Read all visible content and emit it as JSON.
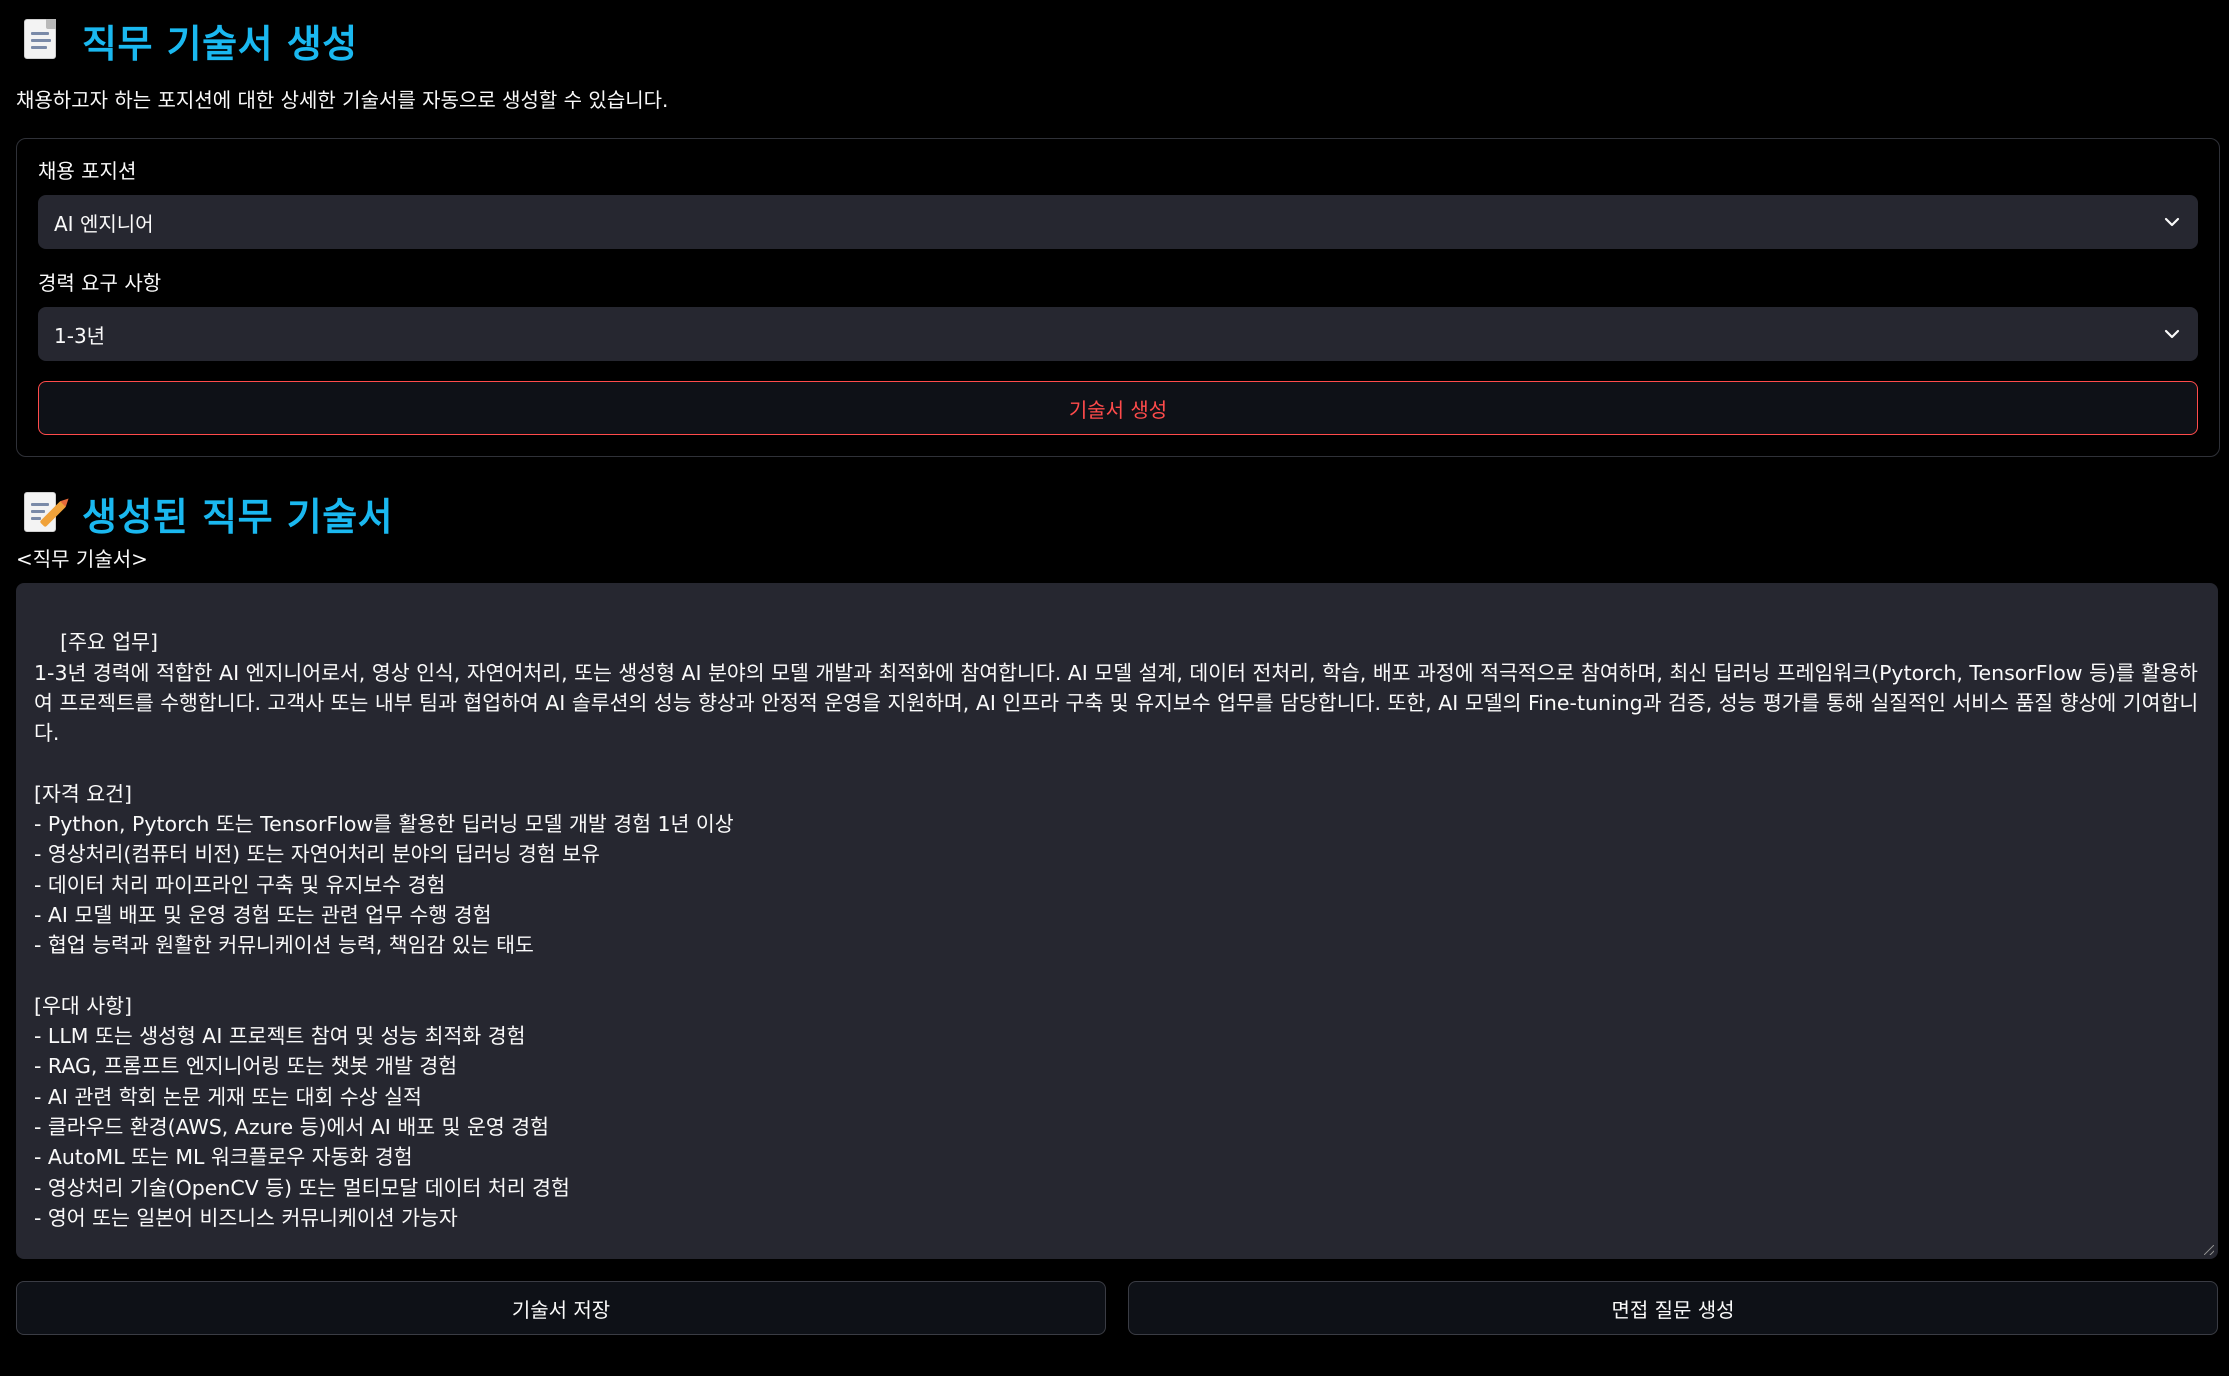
{
  "header": {
    "icon": "page-facing-up-icon",
    "title": "직무 기술서 생성",
    "description": "채용하고자 하는 포지션에 대한 상세한 기술서를 자동으로 생성할 수 있습니다."
  },
  "form": {
    "position": {
      "label": "채용 포지션",
      "selected": "AI 엔지니어"
    },
    "experience": {
      "label": "경력 요구 사항",
      "selected": "1-3년"
    },
    "generate_label": "기술서 생성"
  },
  "output": {
    "icon": "memo-icon",
    "title": "생성된 직무 기술서",
    "field_label": "<직무 기술서>",
    "text": "[주요 업무]\n1-3년 경력에 적합한 AI 엔지니어로서, 영상 인식, 자연어처리, 또는 생성형 AI 분야의 모델 개발과 최적화에 참여합니다. AI 모델 설계, 데이터 전처리, 학습, 배포 과정에 적극적으로 참여하며, 최신 딥러닝 프레임워크(Pytorch, TensorFlow 등)를 활용하여 프로젝트를 수행합니다. 고객사 또는 내부 팀과 협업하여 AI 솔루션의 성능 향상과 안정적 운영을 지원하며, AI 인프라 구축 및 유지보수 업무를 담당합니다. 또한, AI 모델의 Fine-tuning과 검증, 성능 평가를 통해 실질적인 서비스 품질 향상에 기여합니다.\n\n[자격 요건]\n- Python, Pytorch 또는 TensorFlow를 활용한 딥러닝 모델 개발 경험 1년 이상\n- 영상처리(컴퓨터 비전) 또는 자연어처리 분야의 딥러닝 경험 보유\n- 데이터 처리 파이프라인 구축 및 유지보수 경험\n- AI 모델 배포 및 운영 경험 또는 관련 업무 수행 경험\n- 협업 능력과 원활한 커뮤니케이션 능력, 책임감 있는 태도\n\n[우대 사항]\n- LLM 또는 생성형 AI 프로젝트 참여 및 성능 최적화 경험\n- RAG, 프롬프트 엔지니어링 또는 챗봇 개발 경험\n- AI 관련 학회 논문 게재 또는 대회 수상 실적\n- 클라우드 환경(AWS, Azure 등)에서 AI 배포 및 운영 경험\n- AutoML 또는 ML 워크플로우 자동화 경험\n- 영상처리 기술(OpenCV 등) 또는 멀티모달 데이터 처리 경험\n- 영어 또는 일본어 비즈니스 커뮤니케이션 가능자"
  },
  "actions": {
    "save_label": "기술서 저장",
    "interview_label": "면접 질문 생성"
  },
  "colors": {
    "accent_title": "#1ab8f0",
    "primary_button": "#ff4b4b",
    "input_bg": "#262730",
    "page_bg": "#000000"
  }
}
